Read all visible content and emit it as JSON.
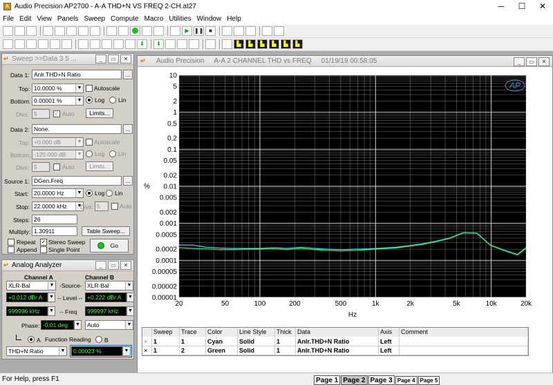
{
  "window": {
    "title": "Audio Precision AP2700 - A-A THD+N VS FREQ 2-CH.at27",
    "min": "─",
    "max": "☐",
    "close": "✕"
  },
  "menu": [
    "File",
    "Edit",
    "View",
    "Panels",
    "Sweep",
    "Compute",
    "Macro",
    "Utilities",
    "Window",
    "Help"
  ],
  "toolbar_icons_1": [
    "new",
    "open",
    "save",
    "print",
    "copy",
    "paste",
    "panel",
    "undo",
    "redo",
    "clear",
    "go",
    "stop",
    "measure",
    "bar",
    "play",
    "pause",
    "stop2",
    "hand",
    "glasses",
    "glasses2",
    "grid",
    "camera"
  ],
  "toolbar_icons_2": [
    "graph",
    "sine",
    "scope",
    "wave",
    "wave2",
    "spec",
    "filter",
    "dac",
    "dsp",
    "mono",
    "meter",
    "down",
    "down2",
    "bar2",
    "table",
    "list",
    "eq",
    "eq2",
    "bars1",
    "bars2",
    "bars3",
    "bars4",
    "bars5",
    "bars6"
  ],
  "sweep": {
    "title": "Sweep >>Data 3 5 ...",
    "data1_label": "Data 1:",
    "data1": "Anlr.THD+N Ratio",
    "top1_label": "Top:",
    "top1": "10.0000  %",
    "autoscale": "Autoscale",
    "bottom1_label": "Bottom:",
    "bottom1": "0.00001  %",
    "log": "Log",
    "lin": "Lin",
    "divs_label": "Divs:",
    "divs1": "5",
    "auto": "Auto",
    "limits": "Limits...",
    "data2_label": "Data 2:",
    "data2": "None.",
    "top2": "+0.000  dB",
    "bottom2": "-120.000 dB",
    "divs2": "5",
    "source_label": "Source 1:",
    "source": "DGen.Freq",
    "start_label": "Start:",
    "start": "20.0000  Hz",
    "stop_label": "Stop:",
    "stop": "22.0000 kHz",
    "divs3": "5",
    "steps_label": "Steps:",
    "steps": "26",
    "multiply_label": "Multiply:",
    "multiply": "1.30911",
    "table_sweep": "Table Sweep...",
    "repeat": "Repeat",
    "stereo": "Stereo Sweep",
    "append": "Append",
    "single": "Single Point",
    "go": "Go"
  },
  "analyzer": {
    "title": "Analog Analyzer",
    "chA": "Channel A",
    "chB": "Channel B",
    "inA": "XLR-Bal",
    "inB": "XLR-Bal",
    "source_label": "-Source-",
    "levelA": "+0.012  dBr A",
    "levelB": "+0.222  dBr A",
    "level_label": "-- Level --",
    "freqA": "999996 kHz",
    "freqB": "999997 kHz",
    "freq_label": "-- Freq",
    "phase_label": "Phase:",
    "phase": "-0.01   deg",
    "phase_mode": "Auto",
    "func_a": "A",
    "func_label": "Function Reading",
    "func_b": "B",
    "func": "THD+N Ratio",
    "reading": "0.00023  %"
  },
  "graph": {
    "title_app": "Audio Precision",
    "title_name": "A-A  2 CHANNEL  THD vs FREQ",
    "title_date": "01/19/19 00:58:05",
    "logo": "AP"
  },
  "chart_data": {
    "type": "line",
    "xlabel": "Hz",
    "ylabel": "%",
    "xscale": "log",
    "yscale": "log",
    "xlim": [
      20,
      20000
    ],
    "ylim": [
      1e-05,
      10
    ],
    "xticks": [
      "20",
      "50",
      "100",
      "200",
      "500",
      "1k",
      "2k",
      "5k",
      "10k",
      "20k"
    ],
    "xtick_values": [
      20,
      50,
      100,
      200,
      500,
      1000,
      2000,
      5000,
      10000,
      20000
    ],
    "yticks": [
      "10",
      "5",
      "2",
      "1",
      "0.5",
      "0.2",
      "0.1",
      "0.05",
      "0.02",
      "0.01",
      "0.005",
      "0.002",
      "0.001",
      "0.0005",
      "0.0002",
      "0.0001",
      "0.00005",
      "0.00002",
      "0.00001"
    ],
    "ytick_values": [
      10,
      5,
      2,
      1,
      0.5,
      0.2,
      0.1,
      0.05,
      0.02,
      0.01,
      0.005,
      0.002,
      0.001,
      0.0005,
      0.0002,
      0.0001,
      5e-05,
      2e-05,
      1e-05
    ],
    "grid": true,
    "background": "#000000",
    "grid_color": "#ffffff",
    "x": [
      20,
      26.2,
      34.3,
      44.9,
      58.8,
      77,
      100.8,
      132,
      172.8,
      226.2,
      296.2,
      387.7,
      507.6,
      664.5,
      869.9,
      1139,
      1491,
      1952,
      2555,
      3345,
      4379,
      5733,
      7505,
      9825,
      12862,
      16838,
      20000
    ],
    "series": [
      {
        "name": "1",
        "color": "#4fd4e8",
        "values": [
          0.00026,
          0.00026,
          0.000225,
          0.000215,
          0.00021,
          0.00021,
          0.00021,
          0.00022,
          0.00021,
          0.000225,
          0.00021,
          0.0002,
          0.000195,
          0.0002,
          0.000205,
          0.000215,
          0.000225,
          0.00025,
          0.00028,
          0.00033,
          0.0004,
          0.00056,
          0.00055,
          0.00026,
          0.00019,
          0.000145,
          0.00022
        ]
      },
      {
        "name": "2",
        "color": "#38e060",
        "values": [
          0.00022,
          0.00021,
          0.000205,
          0.000195,
          0.000195,
          0.0002,
          0.0002,
          0.000205,
          0.000195,
          0.00021,
          0.000195,
          0.000185,
          0.00018,
          0.000185,
          0.000195,
          0.000205,
          0.000215,
          0.00024,
          0.00027,
          0.00032,
          0.00039,
          0.00055,
          0.00054,
          0.000255,
          0.000185,
          0.00014,
          0.00021
        ]
      }
    ]
  },
  "traces_table": {
    "headers": [
      "Sweep",
      "Trace",
      "Color",
      "Line Style",
      "Thick",
      "Data",
      "Axis",
      "Comment"
    ],
    "rows": [
      {
        "check": "×",
        "sweep": "1",
        "trace": "1",
        "color": "Cyan",
        "style": "Solid",
        "thick": "1",
        "data": "Anlr.THD+N Ratio",
        "axis": "Left",
        "comment": ""
      },
      {
        "check": "×",
        "sweep": "1",
        "trace": "2",
        "color": "Green",
        "style": "Solid",
        "thick": "1",
        "data": "Anlr.THD+N Ratio",
        "axis": "Left",
        "comment": ""
      }
    ]
  },
  "status": {
    "help": "For Help, press F1",
    "pages": [
      "Page 1",
      "Page 2",
      "Page 3",
      "Page 4",
      "Page 5"
    ]
  }
}
